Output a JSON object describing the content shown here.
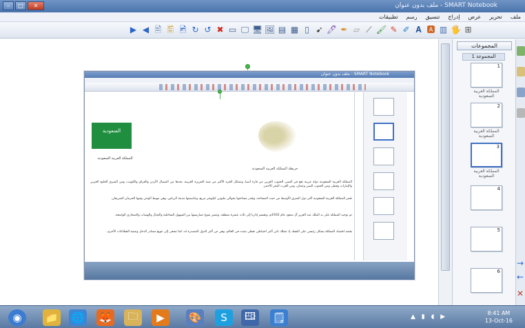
{
  "window": {
    "title": "ملف بدون عنوان - SMART Notebook",
    "min": "–",
    "max": "□",
    "close": "✕"
  },
  "menu": [
    "ملف",
    "تحرير",
    "عرض",
    "إدراج",
    "تنسيق",
    "رسم",
    "تطبيقات"
  ],
  "toolbar": {
    "icons": [
      "▶",
      "◀",
      "🖹",
      "🖺",
      "🖻",
      "↻",
      "↺",
      "✖",
      "▭",
      "🖵",
      "🖥",
      "🖼",
      "▤",
      "▦",
      "▯",
      "➹",
      "🖊",
      "✒",
      "▱",
      "⟋",
      "🖌",
      "✎",
      "✐",
      "𝐀",
      "🅰",
      "▥",
      "🖐",
      "⊞"
    ]
  },
  "side_panel": {
    "pages_label": "المجموعات",
    "group_label": "المجموعة 1",
    "captions": [
      "المملكة العربية السعودية",
      "المملكة العربية السعودية",
      "المملكة العربية السعودية"
    ],
    "thumbs": [
      "1",
      "2",
      "3",
      "4",
      "5",
      "6"
    ]
  },
  "embedded": {
    "title": "ملف بدون عنوان - SMART Notebook",
    "flag_text": "السعودية",
    "flag_caption": "المملكة العربية السعودية",
    "map_caption": "خريطة المملكة العربية السعودية",
    "p1": "المملكة العربية السعودية دولة عربية تقع في أقصى الجنوب الغربي من قارة آسيا، وتشكل الجزء الأكبر من شبه الجزيرة العربية، يحدها من الشمال الأردن والعراق والكويت، ومن الشرق الخليج العربي والإمارات وقطر، ومن الجنوب اليمن وعمان، ومن الغرب البحر الأحمر.",
    "p2": "تعتبر المملكة العربية السعودية أكبر دول الشرق الأوسط من حيث المساحة، وتقدر مساحتها بحوالي مليوني كيلومتر مربع، وعاصمتها مدينة الرياض، وهي مهبط الوحي وفيها الحرمان الشريفان.",
    "p3": "تم توحيد المملكة على يد الملك عبد العزيز آل سعود عام 1932م، وتقسم إداريا إلى ثلاث عشرة منطقة، وتتميز بتنوع تضاريسها بين السهول الساحلية والجبال والهضاب والصحاري الواسعة.",
    "p4": "يعتمد اقتصاد المملكة بشكل رئيسي على النفط، إذ تمتلك ثاني أكبر احتياطي نفطي مثبت في العالم، وهي من أكبر الدول المصدرة له، كما تسعى إلى تنويع مصادر الدخل وتنمية القطاعات الأخرى."
  },
  "taskbar": {
    "icons": [
      "◉",
      "📁",
      "🌐",
      "🦊",
      "🗀",
      "▶",
      "🎨",
      "S",
      "🖽",
      "🗒"
    ],
    "time": "8:41 AM",
    "date": "13-Oct-16"
  }
}
